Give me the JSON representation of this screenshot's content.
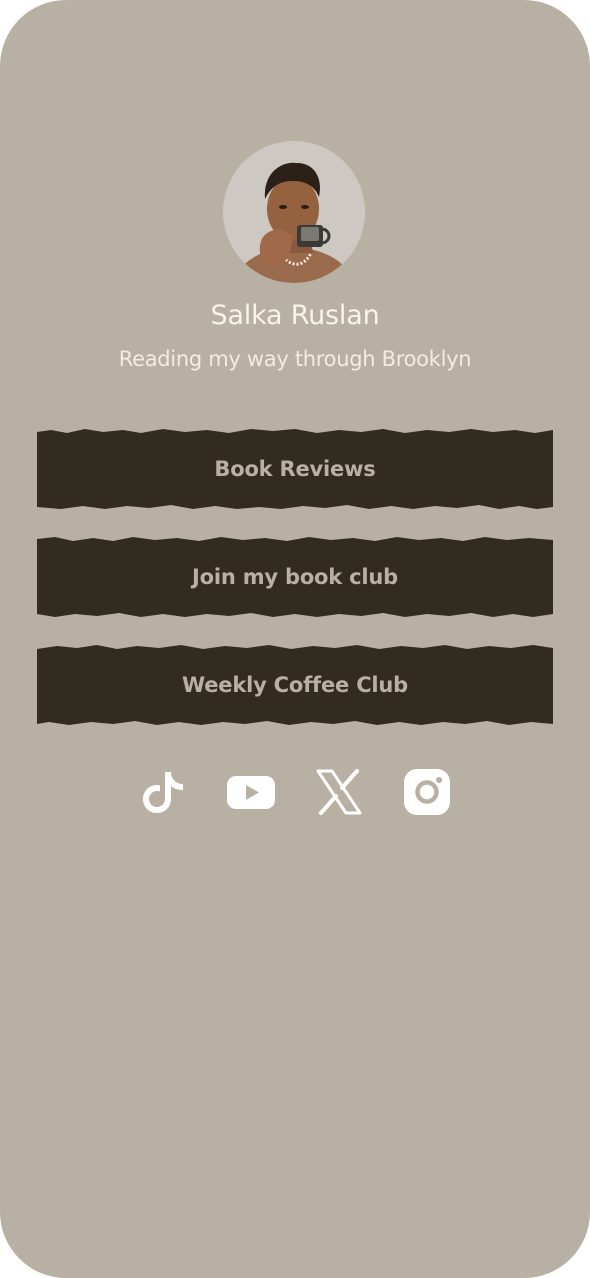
{
  "profile": {
    "name": "Salka Ruslan",
    "bio": "Reading my way through Brooklyn",
    "avatar_icon": "avatar-photo"
  },
  "links": [
    {
      "label": "Book Reviews"
    },
    {
      "label": "Join my book club"
    },
    {
      "label": "Weekly Coffee Club"
    }
  ],
  "social": [
    {
      "icon": "tiktok-icon"
    },
    {
      "icon": "youtube-icon"
    },
    {
      "icon": "x-icon"
    },
    {
      "icon": "instagram-icon"
    }
  ],
  "colors": {
    "background": "#b8b0a2",
    "button": "#322c20",
    "button_text": "#b8b0a2",
    "text": "#f7f4ee",
    "icon": "#ffffff"
  }
}
